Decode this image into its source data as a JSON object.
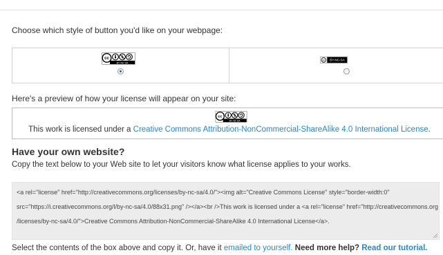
{
  "prompts": {
    "style_question": "Choose which style of button you'd like on your webpage:",
    "preview_intro": "Here's a preview of how your license will appear on your site:"
  },
  "button_styles": {
    "options": [
      {
        "name": "normal",
        "badge_text": "BY NC SA",
        "selected": true
      },
      {
        "name": "compact",
        "badge_text": "BY-NC-SA",
        "selected": false
      }
    ]
  },
  "preview": {
    "badge_text": "BY NC SA",
    "text_before": "This work is licensed under a ",
    "license_link": "Creative Commons Attribution-NonCommercial-ShareAlike 4.0 International License",
    "text_after": "."
  },
  "own_website": {
    "heading": "Have your own website?",
    "description": "Copy the text below to your Web site to let your visitors know what license applies to your works."
  },
  "embed_code": {
    "lines": [
      "<a rel=\"license\" href=\"http://creativecommons.org/licenses/by-nc-sa/4.0/\"><img alt=\"Creative Commons License\" style=\"border-width:0\"",
      "src=\"https://i.creativecommons.org/l/by-nc-sa/4.0/88x31.png\" /></a><br />This work is licensed under a <a rel=\"license\" href=\"http://creativecommons.org",
      "/licenses/by-nc-sa/4.0/\">Creative Commons Attribution-NonCommercial-ShareAlike 4.0 International License</a>."
    ]
  },
  "footer": {
    "text1": "Select the contents of the box above and copy it. Or, have it ",
    "email_link": "emailed to yourself.",
    "help_text": " Need more help? ",
    "tutorial_link": "Read our tutorial."
  }
}
